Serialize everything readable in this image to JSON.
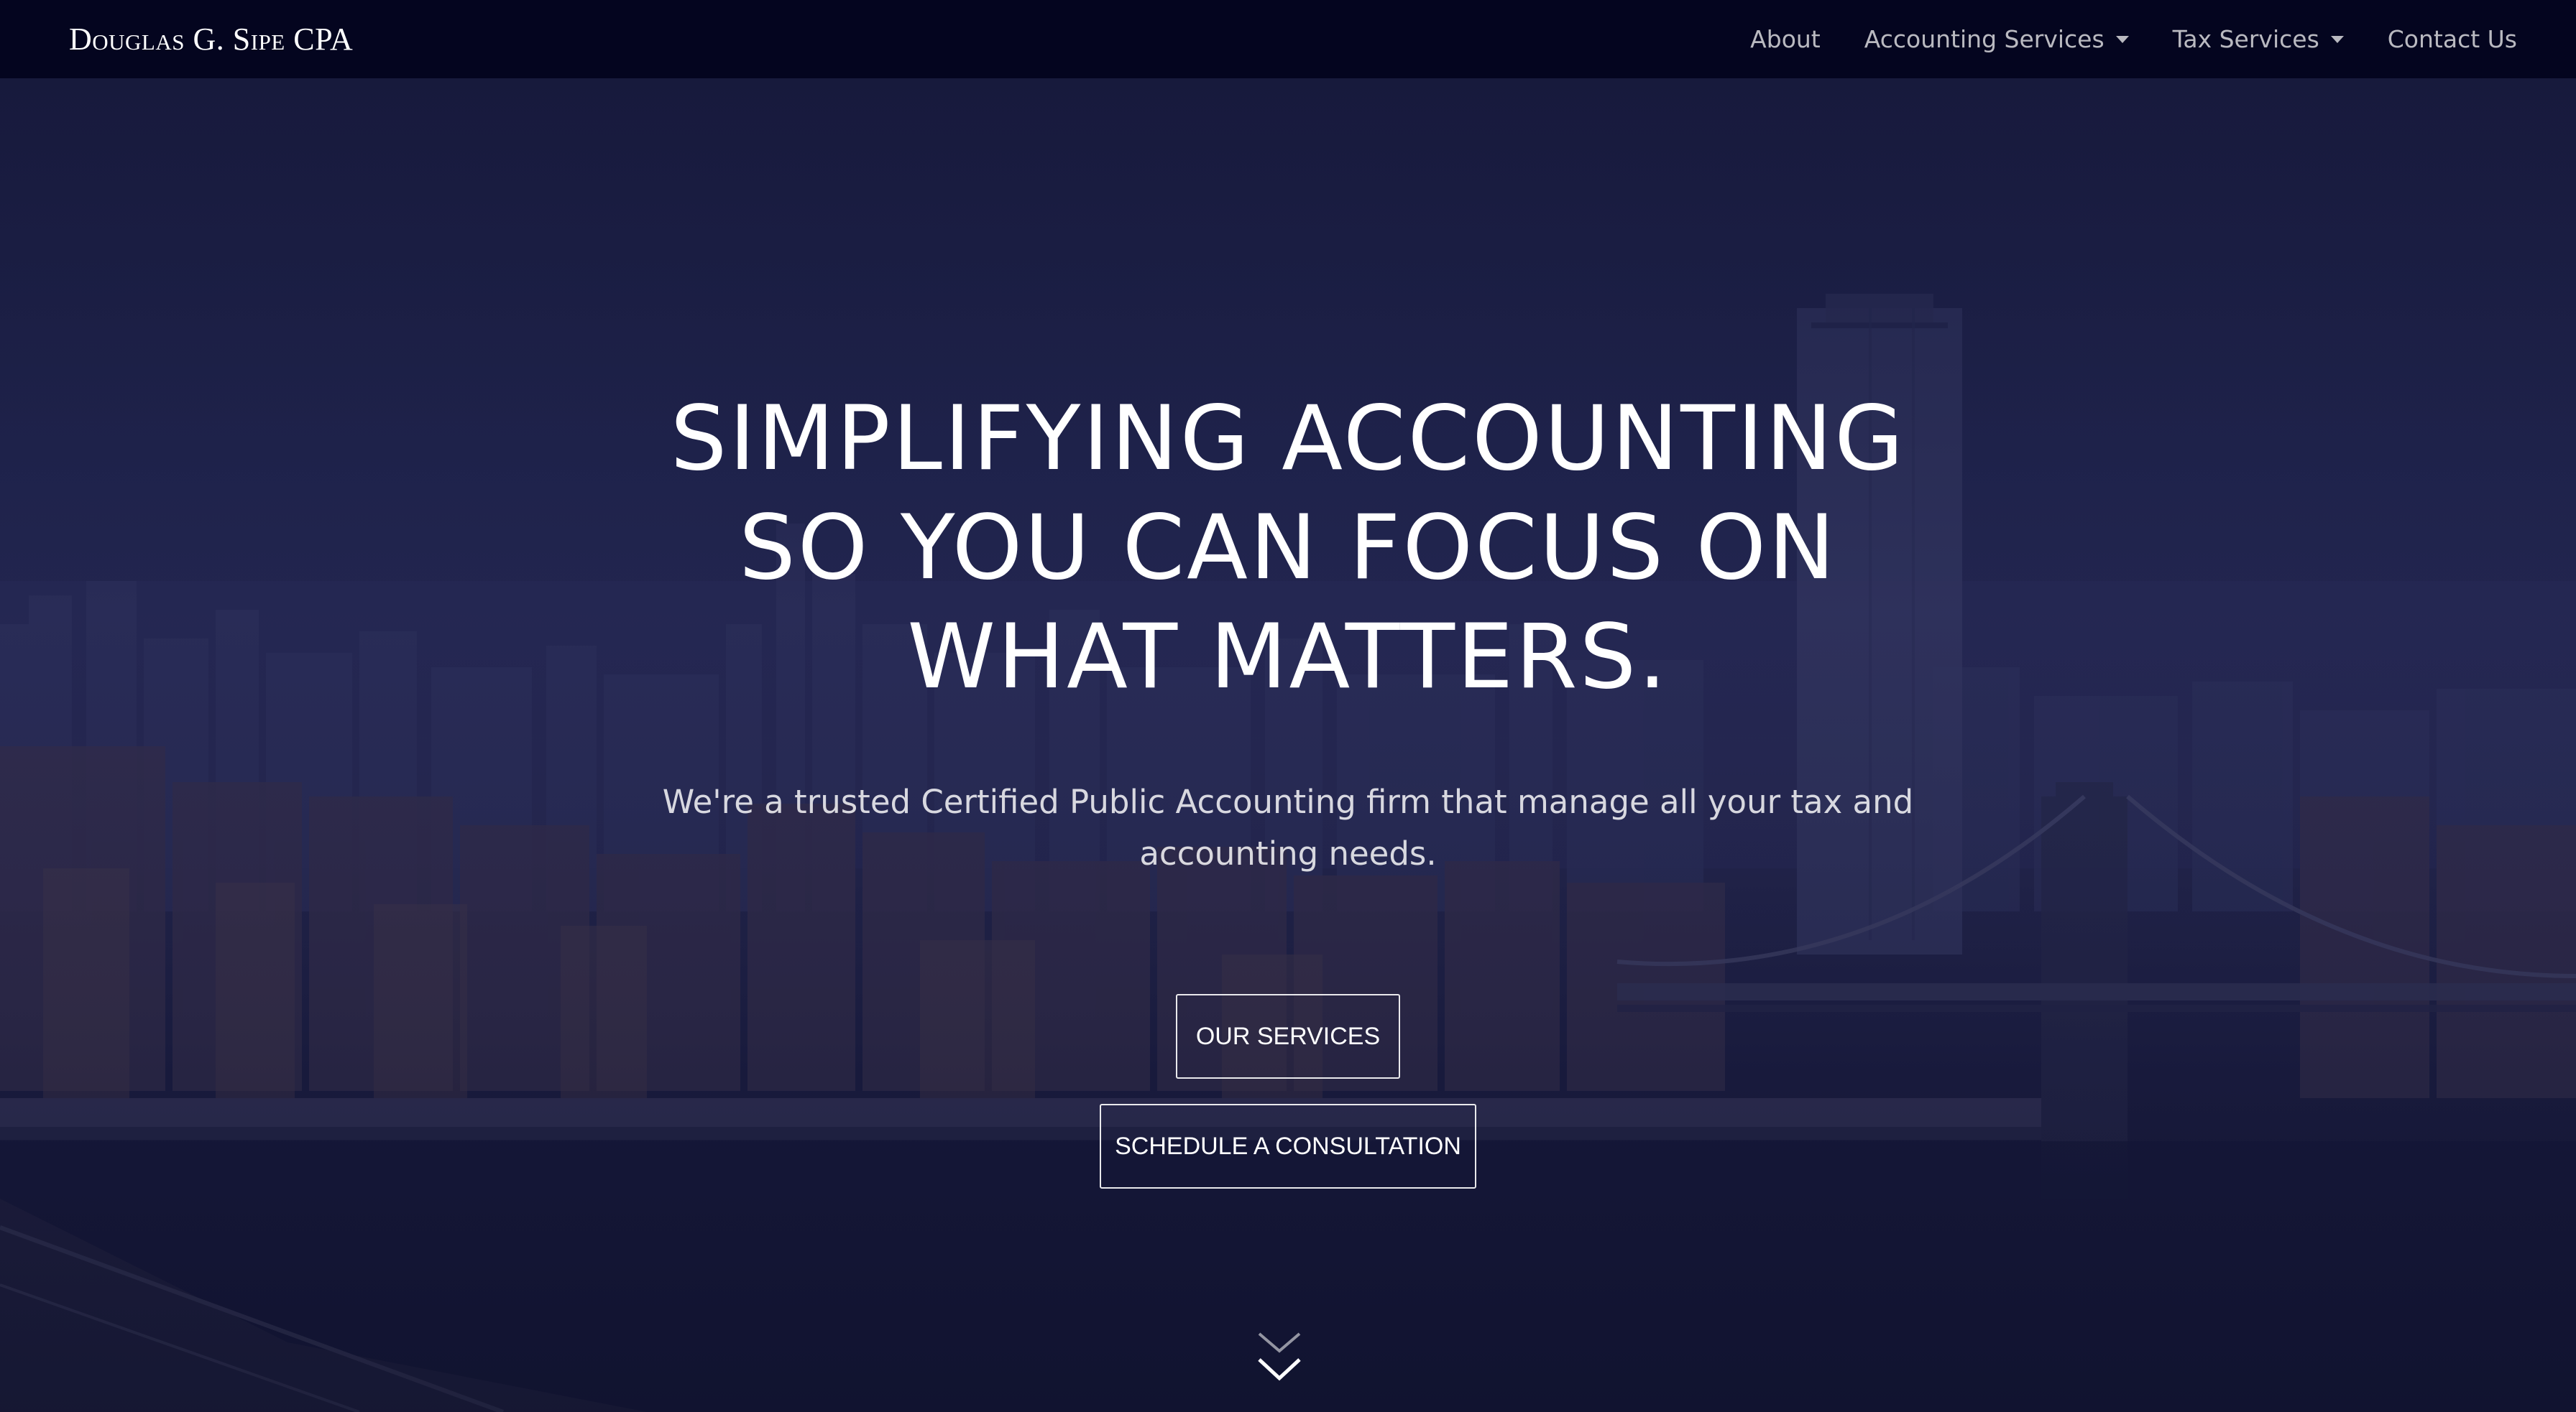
{
  "navbar": {
    "brand": "Douglas G. Sipe CPA",
    "items": [
      {
        "label": "About",
        "dropdown": false
      },
      {
        "label": "Accounting Services",
        "dropdown": true
      },
      {
        "label": "Tax Services",
        "dropdown": true
      },
      {
        "label": "Contact Us",
        "dropdown": false
      }
    ]
  },
  "hero": {
    "headline_lines": [
      "Simplifying Accounting",
      "So You Can Focus On",
      "What Matters."
    ],
    "subtext_lines": [
      "We're a trusted Certified Public Accounting firm that manage all your tax and",
      "accounting needs."
    ],
    "buttons": {
      "services": "Our Services",
      "consultation": "Schedule a Consultation"
    },
    "scroll_icon": "double-chevron-down-icon"
  },
  "colors": {
    "navbar_bg": "#04051f",
    "hero_tint": "#252a55",
    "text": "#ffffff"
  }
}
